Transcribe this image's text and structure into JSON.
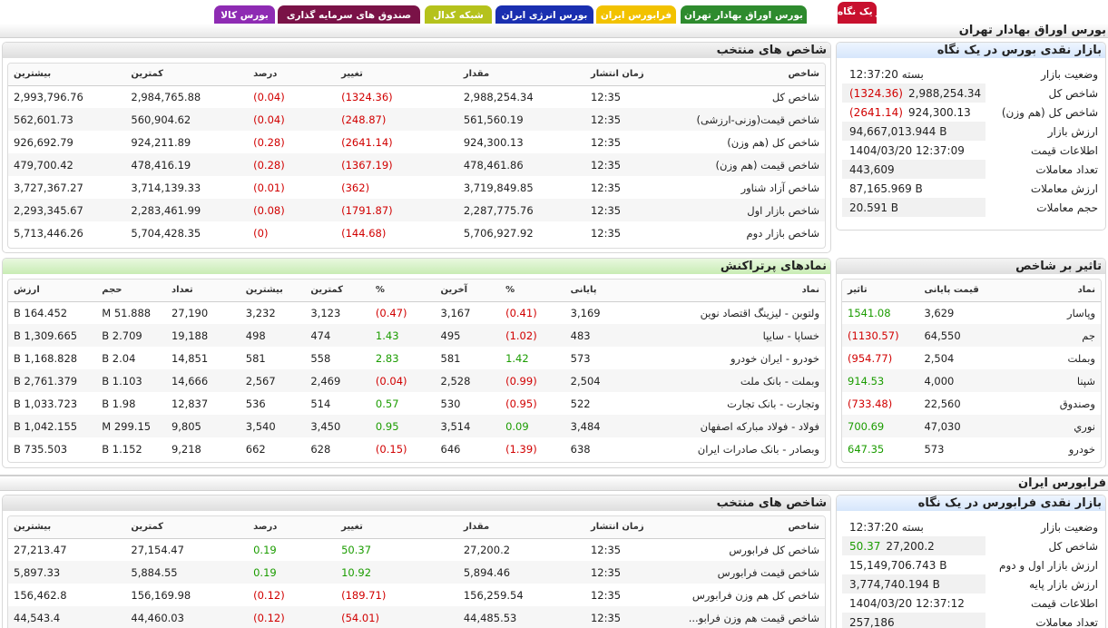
{
  "tabs": [
    {
      "label": "در یک نگاه",
      "bg": "#c8102e",
      "fg": "#ffffff"
    },
    {
      "label": "بورس اوراق بهادار تهران",
      "bg": "#2e8b2e",
      "fg": "#ffffff"
    },
    {
      "label": "فرابورس ایران",
      "bg": "#f2c200",
      "fg": "#ffffff"
    },
    {
      "label": "بورس انرژی ایران",
      "bg": "#1a2fb0",
      "fg": "#ffffff"
    },
    {
      "label": "شبکه کدال",
      "bg": "#b5c21c",
      "fg": "#ffffff"
    },
    {
      "label": "صندوق های سرمایه گذاری",
      "bg": "#7a1247",
      "fg": "#ffffff"
    },
    {
      "label": "بورس کالا",
      "bg": "#8e2bb3",
      "fg": "#ffffff"
    }
  ],
  "tse": {
    "section_title": "بورس اوراق بهادار تهران",
    "summary": {
      "title": "بازار نقدی بورس در یک نگاه",
      "rows": [
        {
          "key": "وضعیت بازار",
          "value": "بسته 12:37:20",
          "change": ""
        },
        {
          "key": "شاخص کل",
          "value": "2,988,254.34",
          "change": "(1324.36)"
        },
        {
          "key": "شاخص کل (هم وزن)",
          "value": "924,300.13",
          "change": "(2641.14)"
        },
        {
          "key": "ارزش بازار",
          "value": "94,667,013.944 B",
          "change": ""
        },
        {
          "key": "اطلاعات قیمت",
          "value": "1404/03/20 12:37:09",
          "change": ""
        },
        {
          "key": "تعداد معاملات",
          "value": "443,609",
          "change": ""
        },
        {
          "key": "ارزش معاملات",
          "value": "87,165.969 B",
          "change": ""
        },
        {
          "key": "حجم معاملات",
          "value": "20.591 B",
          "change": ""
        }
      ]
    },
    "indices": {
      "title": "شاخص های منتخب",
      "headers": [
        "شاخص",
        "زمان انتشار",
        "مقدار",
        "تغییر",
        "درصد",
        "کمترین",
        "بیشترین"
      ],
      "rows": [
        [
          "شاخص کل",
          "12:35",
          "2,988,254.34",
          "(1324.36)",
          "(0.04)",
          "2,984,765.88",
          "2,993,796.76"
        ],
        [
          "شاخص قیمت(وزنی-ارزشی)",
          "12:35",
          "561,560.19",
          "(248.87)",
          "(0.04)",
          "560,904.62",
          "562,601.73"
        ],
        [
          "شاخص کل (هم وزن)",
          "12:35",
          "924,300.13",
          "(2641.14)",
          "(0.28)",
          "924,211.89",
          "926,692.79"
        ],
        [
          "شاخص قیمت (هم وزن)",
          "12:35",
          "478,461.86",
          "(1367.19)",
          "(0.28)",
          "478,416.19",
          "479,700.42"
        ],
        [
          "شاخص آزاد شناور",
          "12:35",
          "3,719,849.85",
          "(362)",
          "(0.01)",
          "3,714,139.33",
          "3,727,367.27"
        ],
        [
          "شاخص بازار اول",
          "12:35",
          "2,287,775.76",
          "(1791.87)",
          "(0.08)",
          "2,283,461.99",
          "2,293,345.67"
        ],
        [
          "شاخص بازار دوم",
          "12:35",
          "5,706,927.92",
          "(144.68)",
          "(0)",
          "5,704,428.35",
          "5,713,446.26"
        ]
      ]
    },
    "impact": {
      "title": "تاثیر بر شاخص",
      "headers": [
        "نماد",
        "قیمت پایانی",
        "تاثیر"
      ],
      "rows": [
        [
          "وپاسار",
          "3,629",
          "1541.08"
        ],
        [
          "جم",
          "64,550",
          "(1130.57)"
        ],
        [
          "وبملت",
          "2,504",
          "(954.77)"
        ],
        [
          "شپنا",
          "4,000",
          "914.53"
        ],
        [
          "وصندوق",
          "22,560",
          "(733.48)"
        ],
        [
          "نوري",
          "47,030",
          "700.69"
        ],
        [
          "خودرو",
          "573",
          "647.35"
        ]
      ]
    },
    "active": {
      "title": "نمادهای پرتراکنش",
      "headers": [
        "نماد",
        "پایانی",
        "%",
        "آخرین",
        "%",
        "کمترین",
        "بیشترین",
        "تعداد",
        "حجم",
        "ارزش"
      ],
      "rows": [
        [
          "ولتوبن - لیزینگ اقتصاد نوین",
          "3,169",
          "(0.41)",
          "3,167",
          "(0.47)",
          "3,123",
          "3,232",
          "27,190",
          "51.888 M",
          "164.452 B"
        ],
        [
          "خساپا - سایپا",
          "483",
          "(1.02)",
          "495",
          "1.43",
          "474",
          "498",
          "19,188",
          "2.709 B",
          "1,309.665 B"
        ],
        [
          "خودرو - ایران خودرو",
          "573",
          "1.42",
          "581",
          "2.83",
          "558",
          "581",
          "14,851",
          "2.04 B",
          "1,168.828 B"
        ],
        [
          "وبملت - بانک ملت",
          "2,504",
          "(0.99)",
          "2,528",
          "(0.04)",
          "2,469",
          "2,567",
          "14,666",
          "1.103 B",
          "2,761.379 B"
        ],
        [
          "وتجارت - بانک تجارت",
          "522",
          "(0.95)",
          "530",
          "0.57",
          "514",
          "536",
          "12,837",
          "1.98 B",
          "1,033.723 B"
        ],
        [
          "فولاد - فولاد مبارکه اصفهان",
          "3,484",
          "0.09",
          "3,514",
          "0.95",
          "3,450",
          "3,540",
          "9,805",
          "299.15 M",
          "1,042.155 B"
        ],
        [
          "وبصادر - بانک صادرات ایران",
          "638",
          "(1.39)",
          "646",
          "(0.15)",
          "628",
          "662",
          "9,218",
          "1.152 B",
          "735.503 B"
        ]
      ]
    }
  },
  "ifb": {
    "section_title": "فرابورس ایران",
    "summary": {
      "title": "بازار نقدی فرابورس در یک نگاه",
      "rows": [
        {
          "key": "وضعیت بازار",
          "value": "بسته 12:37:20",
          "change": ""
        },
        {
          "key": "شاخص کل",
          "value": "27,200.2",
          "change": "50.37"
        },
        {
          "key": "ارزش بازار اول و دوم",
          "value": "15,149,706.743 B",
          "change": ""
        },
        {
          "key": "ارزش بازار پایه",
          "value": "3,774,740.194 B",
          "change": ""
        },
        {
          "key": "اطلاعات قیمت",
          "value": "1404/03/20 12:37:12",
          "change": ""
        },
        {
          "key": "تعداد معاملات",
          "value": "257,186",
          "change": ""
        }
      ]
    },
    "indices": {
      "title": "شاخص های منتخب",
      "headers": [
        "شاخص",
        "زمان انتشار",
        "مقدار",
        "تغییر",
        "درصد",
        "کمترین",
        "بیشترین"
      ],
      "rows": [
        [
          "شاخص کل فرابورس",
          "12:35",
          "27,200.2",
          "50.37",
          "0.19",
          "27,154.47",
          "27,213.47"
        ],
        [
          "شاخص قیمت فرابورس",
          "12:35",
          "5,894.46",
          "10.92",
          "0.19",
          "5,884.55",
          "5,897.33"
        ],
        [
          "شاخص کل هم وزن فرابورس",
          "12:35",
          "156,259.54",
          "(189.71)",
          "(0.12)",
          "156,169.98",
          "156,462.8"
        ],
        [
          "شاخص قیمت هم وزن فرابو...",
          "12:35",
          "44,485.53",
          "(54.01)",
          "(0.12)",
          "44,460.03",
          "44,543.4"
        ]
      ]
    }
  }
}
